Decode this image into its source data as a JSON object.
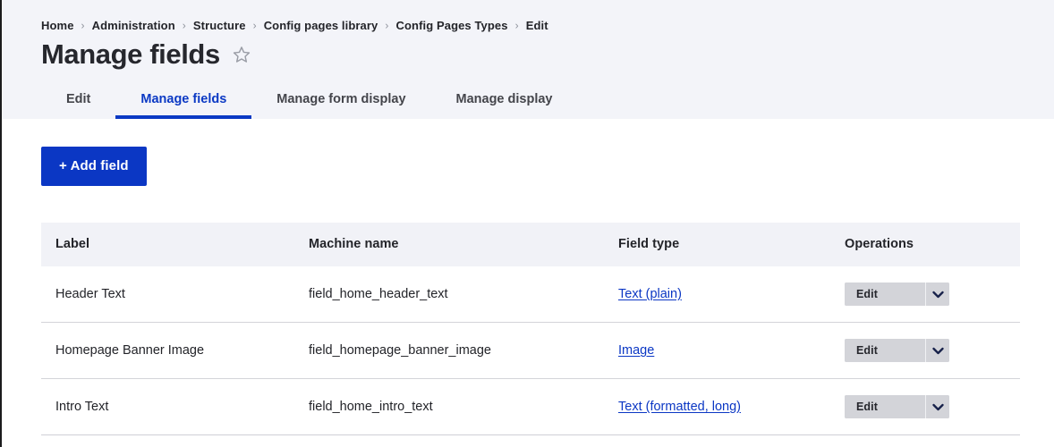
{
  "breadcrumb": {
    "separator": "›",
    "items": [
      {
        "label": "Home"
      },
      {
        "label": "Administration"
      },
      {
        "label": "Structure"
      },
      {
        "label": "Config pages library"
      },
      {
        "label": "Config Pages Types"
      },
      {
        "label": "Edit"
      }
    ]
  },
  "header": {
    "title": "Manage fields",
    "star_icon": "star-outline-icon"
  },
  "tabs": [
    {
      "label": "Edit",
      "active": false
    },
    {
      "label": "Manage fields",
      "active": true
    },
    {
      "label": "Manage form display",
      "active": false
    },
    {
      "label": "Manage display",
      "active": false
    }
  ],
  "toolbar": {
    "add_field_label": "+ Add field"
  },
  "table": {
    "columns": [
      {
        "key": "label",
        "label": "Label"
      },
      {
        "key": "machine_name",
        "label": "Machine name"
      },
      {
        "key": "field_type",
        "label": "Field type"
      },
      {
        "key": "operations",
        "label": "Operations"
      }
    ],
    "rows": [
      {
        "label": "Header Text",
        "machine_name": "field_home_header_text",
        "field_type": "Text (plain)",
        "operation_label": "Edit",
        "operation_toggle_icon": "chevron-down-icon"
      },
      {
        "label": "Homepage Banner Image",
        "machine_name": "field_homepage_banner_image",
        "field_type": "Image",
        "operation_label": "Edit",
        "operation_toggle_icon": "chevron-down-icon"
      },
      {
        "label": "Intro Text",
        "machine_name": "field_home_intro_text",
        "field_type": "Text (formatted, long)",
        "operation_label": "Edit",
        "operation_toggle_icon": "chevron-down-icon"
      }
    ]
  },
  "colors": {
    "primary": "#0b37c4",
    "link": "#0b37c4",
    "header_bg": "#f3f4f9",
    "table_head_bg": "#f1f2f7",
    "button_gray": "#d3d4d9",
    "text": "#232429"
  }
}
